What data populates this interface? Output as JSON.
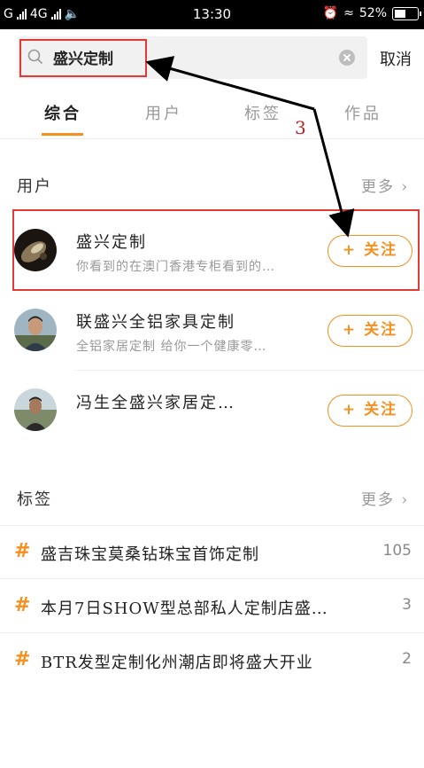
{
  "status_bar": {
    "carrier": "G",
    "network": "4G",
    "time": "13:30",
    "battery": "52%"
  },
  "search": {
    "query": "盛兴定制",
    "cancel_label": "取消"
  },
  "tabs": [
    {
      "label": "综合",
      "active": true
    },
    {
      "label": "用户",
      "active": false
    },
    {
      "label": "标签",
      "active": false
    },
    {
      "label": "作品",
      "active": false
    }
  ],
  "users_section": {
    "title": "用户",
    "more_label": "更多",
    "follow_label": "+ 关注",
    "items": [
      {
        "name": "盛兴定制",
        "desc": "你看到的在澳门香港专柜看到的…"
      },
      {
        "name": "联盛兴全铝家具定制",
        "desc": "全铝家居定制 给你一个健康零…"
      },
      {
        "name": "冯生全盛兴家居定…",
        "desc": ""
      }
    ]
  },
  "tags_section": {
    "title": "标签",
    "more_label": "更多",
    "items": [
      {
        "label": "盛吉珠宝莫桑钻珠宝首饰定制",
        "count": "105"
      },
      {
        "label": "本月7日SHOW型总部私人定制店盛…",
        "count": "3"
      },
      {
        "label": "BTR发型定制化州潮店即将盛大开业",
        "count": "2"
      }
    ]
  },
  "annotation": {
    "label": "3"
  },
  "colors": {
    "accent": "#f5901e",
    "highlight": "#e53935"
  }
}
